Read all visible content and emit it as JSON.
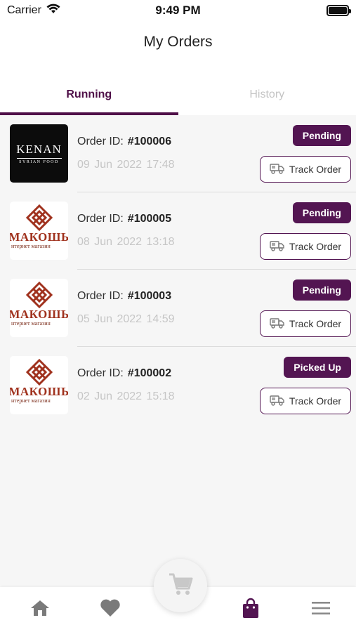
{
  "status_bar": {
    "carrier": "Carrier",
    "time": "9:49 PM"
  },
  "header": {
    "title": "My Orders"
  },
  "tabs": [
    {
      "label": "Running",
      "active": true
    },
    {
      "label": "History",
      "active": false
    }
  ],
  "orders": [
    {
      "logo": "Kenan Syrian Food logo",
      "logo_text": "KENAN",
      "logo_subtext": "SYRIAN FOOD",
      "id_label": "Order ID:",
      "id": "#100006",
      "date": "09 Jun 2022",
      "time": "17:48",
      "status": "Pending",
      "track_label": "Track Order"
    },
    {
      "logo": "Makosh store logo",
      "logo_text": "МАКОШЬ",
      "logo_subtext": "нтернет магазин",
      "id_label": "Order ID:",
      "id": "#100005",
      "date": "08 Jun 2022",
      "time": "13:18",
      "status": "Pending",
      "track_label": "Track Order"
    },
    {
      "logo": "Makosh store logo",
      "logo_text": "МАКОШЬ",
      "logo_subtext": "нтернет магазин",
      "id_label": "Order ID:",
      "id": "#100003",
      "date": "05 Jun 2022",
      "time": "14:59",
      "status": "Pending",
      "track_label": "Track Order"
    },
    {
      "logo": "Makosh store logo",
      "logo_text": "МАКОШЬ",
      "logo_subtext": "нтернет магазин",
      "id_label": "Order ID:",
      "id": "#100002",
      "date": "02 Jun 2022",
      "time": "15:18",
      "status": "Picked Up",
      "track_label": "Track Order"
    }
  ],
  "bottom_nav": {
    "items": [
      {
        "icon": "home-icon",
        "active": false
      },
      {
        "icon": "heart-icon",
        "active": false
      },
      {
        "icon": "cart-icon",
        "active": false
      },
      {
        "icon": "shopping-bag-icon",
        "active": true
      },
      {
        "icon": "menu-icon",
        "active": false
      }
    ]
  },
  "colors": {
    "accent": "#531552",
    "tab_active": "#4f1048",
    "muted_text": "#c6c6c6",
    "list_background": "#f6f6f6"
  }
}
